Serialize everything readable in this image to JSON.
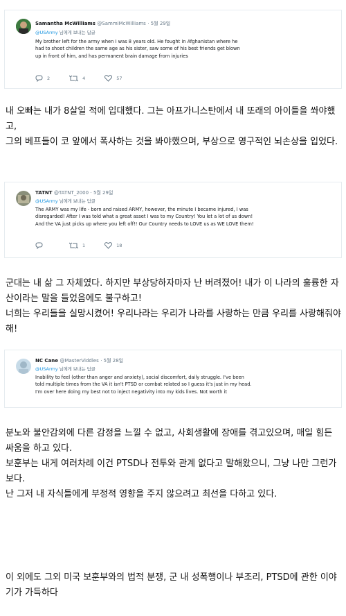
{
  "tweets": [
    {
      "name": "Samantha McWilliams",
      "handle": "@SammiMcWilliams",
      "date": "5월 29일",
      "reply_to": "@USArmy",
      "reply_suffix": "님에게 보내는 답글",
      "text": "My brother left for the army when I was 8 years old. He fought in Afghanistan where he had to shoot children the same age as his sister, saw some of his best friends get blown up in front of him, and has permanent brain damage from injuries",
      "replies": "2",
      "retweets": "4",
      "likes": "57"
    },
    {
      "name": "TATNT",
      "handle": "@TATNT_2000",
      "date": "5월 29일",
      "reply_to": "@USArmy",
      "reply_suffix": "님에게 보내는 답글",
      "text": "The ARMY was my life - born and raised ARMY, however, the minute I became injured, I was disregarded! After I was told what a great asset I was to my Country! You let a lot of us down! And the VA just picks up where you left off!! Our Country needs to LOVE us as WE LOVE them!",
      "replies": "",
      "retweets": "1",
      "likes": "18"
    },
    {
      "name": "NC Cane",
      "handle": "@MasterViddles",
      "date": "5월 28일",
      "reply_to": "@USArmy",
      "reply_suffix": "님에게 보내는 답글",
      "text": "Inability to feel (other than anger and anxiety), social discomfort, daily struggle. I've been told multiple times from the VA it isn't PTSD or combat related so I guess it's just in my head. I'm over here doing my best not to inject negativity into my kids lives. Not worth it"
    }
  ],
  "translations": [
    [
      "내 오빠는 내가 8살일 적에 입대했다. 그는 아프가니스탄에서 내 또래의 아이들을 쏴야했고,",
      "그의 베프들이 코 앞에서 폭사하는 것을 봐야했으며, 부상으로 영구적인 뇌손상을 입었다."
    ],
    [
      "군대는 내 삶 그 자체였다. 하지만 부상당하자마자 난 버려졌어! 내가 이 나라의 훌륭한 자산이라는 말을 들었음에도 불구하고!",
      "너희는 우리들을 실망시켰어! 우리나라는 우리가 나라를 사랑하는 만큼 우리를 사랑해줘야해!"
    ],
    [
      "분노와 불안감외에 다른 감정을 느낄 수 없고, 사회생활에 장애를 겪고있으며, 매일 힘든 싸움을 하고 있다.",
      "보훈부는 내게 여러차례 이건 PTSD나 전투와 관계 없다고 말해왔으니, 그냥 나만 그런가보다.",
      "난 그저 내 자식들에게 부정적 영향을 주지 않으려고 최선을 다하고 있다."
    ]
  ],
  "footer": "이 외에도 그외 미국 보훈부와의 법적 분쟁, 군 내 성폭행이나 부조리, PTSD에 관한 이야기가 가득하다"
}
